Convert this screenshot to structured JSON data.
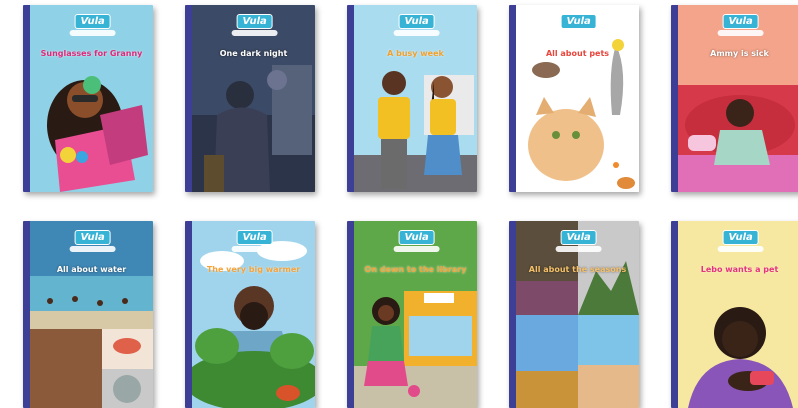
{
  "brand": "Vula",
  "books": [
    {
      "title": "Sunglasses for Granny",
      "title_color": "#e0287a"
    },
    {
      "title": "One dark night",
      "title_color": "#ffffff"
    },
    {
      "title": "A busy week",
      "title_color": "#f2a02c"
    },
    {
      "title": "All about pets",
      "title_color": "#e8463d"
    },
    {
      "title": "Ammy is sick",
      "title_color": "#ffffff"
    },
    {
      "title": "All about water",
      "title_color": "#ffffff"
    },
    {
      "title": "The very big warmer",
      "title_color": "#f4a33b"
    },
    {
      "title": "On down to the library",
      "title_color": "#f4a33b"
    },
    {
      "title": "All about the seasons",
      "title_color": "#f4c06a"
    },
    {
      "title": "Lebo wants a pet",
      "title_color": "#e6337a"
    }
  ],
  "colors": {
    "spine": "#3d3f96",
    "logo": "#37b3d6"
  }
}
